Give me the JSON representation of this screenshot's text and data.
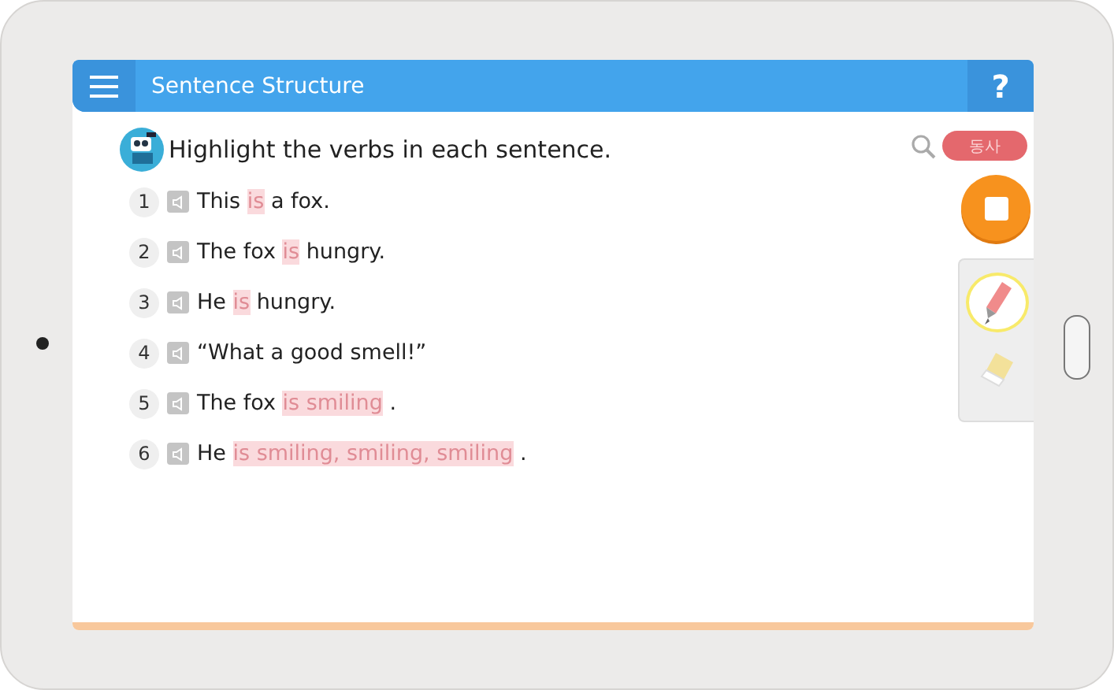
{
  "header": {
    "title": "Sentence Structure",
    "help": "?"
  },
  "instruction": {
    "text": "Highlight the verbs in each sentence."
  },
  "tag": {
    "label": "동사"
  },
  "sentences": [
    {
      "number": "1",
      "segments": [
        {
          "text": "This ",
          "highlighted": false
        },
        {
          "text": "is",
          "highlighted": true
        },
        {
          "text": " a fox.",
          "highlighted": false
        }
      ]
    },
    {
      "number": "2",
      "segments": [
        {
          "text": "The fox ",
          "highlighted": false
        },
        {
          "text": "is",
          "highlighted": true
        },
        {
          "text": " hungry.",
          "highlighted": false
        }
      ]
    },
    {
      "number": "3",
      "segments": [
        {
          "text": "He ",
          "highlighted": false
        },
        {
          "text": "is",
          "highlighted": true
        },
        {
          "text": " hungry.",
          "highlighted": false
        }
      ]
    },
    {
      "number": "4",
      "segments": [
        {
          "text": "“What a good smell!”",
          "highlighted": false
        }
      ]
    },
    {
      "number": "5",
      "segments": [
        {
          "text": "The fox ",
          "highlighted": false
        },
        {
          "text": "is smiling",
          "highlighted": true
        },
        {
          "text": " .",
          "highlighted": false
        }
      ]
    },
    {
      "number": "6",
      "segments": [
        {
          "text": "He ",
          "highlighted": false
        },
        {
          "text": "is smiling, smiling, smiling",
          "highlighted": true
        },
        {
          "text": " .",
          "highlighted": false
        }
      ]
    }
  ],
  "tools": [
    {
      "kind": "pen",
      "selected": true
    },
    {
      "kind": "eraser",
      "selected": false
    }
  ]
}
